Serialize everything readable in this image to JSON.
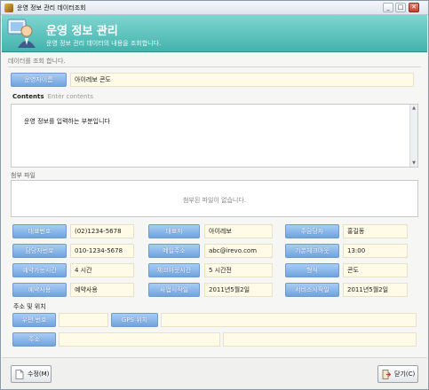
{
  "window": {
    "title": "운영 정보 관리 데이터조회",
    "min": "_",
    "max": "□",
    "close": "✕"
  },
  "header": {
    "title": "운영 정보 관리",
    "subtitle": "운영 정보 관리 데이터의 내용을 조회합니다."
  },
  "notice": "데이터를 조회 합니다.",
  "op_name": {
    "label": "운영자이름",
    "value": "아이레보 콘도"
  },
  "contents": {
    "title": "Contents",
    "placeholder": "Enter contents",
    "text": "운영 정보를 입력하는 부분입니다"
  },
  "attachments": {
    "title": "첨부 파일",
    "empty": "첨부된 파일이 없습니다."
  },
  "fields": {
    "rep_phone": {
      "label": "대표번호",
      "value": "(02)1234-5678"
    },
    "rep": {
      "label": "대표자",
      "value": "아이레보"
    },
    "manager": {
      "label": "주담당자",
      "value": "홍길동"
    },
    "mgr_phone": {
      "label": "담당자번호",
      "value": "010-1234-5678"
    },
    "email": {
      "label": "메일주소",
      "value": "abc@irevo.com"
    },
    "checkin": {
      "label": "기본체크아웃",
      "value": "13:00"
    },
    "basic_time": {
      "label": "예약가능시간",
      "value": "4 시간"
    },
    "checkout_hours": {
      "label": "체크아웃시간",
      "value": "5 시간전"
    },
    "type": {
      "label": "형식",
      "value": "콘도"
    },
    "biz_use": {
      "label": "예약사용",
      "value": "예약사용"
    },
    "biz_start": {
      "label": "사업시작일",
      "value": "2011년5월2일"
    },
    "svc_start": {
      "label": "서비스시작일",
      "value": "2011년5월2일"
    }
  },
  "address": {
    "title": "주소 및 위치",
    "zip_label": "우편 번호",
    "zip_value": "",
    "gps_label": "GPS 위치",
    "gps_value": "",
    "addr_label": "주소",
    "addr_value1": "",
    "addr_value2": ""
  },
  "footer": {
    "edit": "수정(M)",
    "close": "닫기(C)"
  }
}
